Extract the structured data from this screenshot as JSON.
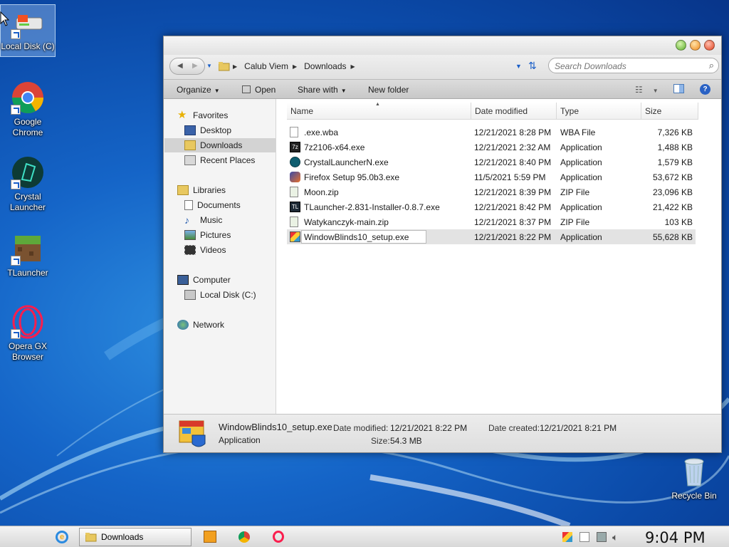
{
  "desktop": {
    "icons": [
      {
        "label": "Local Disk (C)"
      },
      {
        "label": "Google Chrome"
      },
      {
        "label": "Crystal Launcher"
      },
      {
        "label": "TLauncher"
      },
      {
        "label": "Opera GX Browser"
      },
      {
        "label": "Recycle Bin"
      }
    ]
  },
  "explorer": {
    "breadcrumb": [
      "Calub Viem",
      "Downloads"
    ],
    "search_placeholder": "Search Downloads",
    "toolbar": {
      "organize": "Organize",
      "open": "Open",
      "share_with": "Share with",
      "new_folder": "New folder"
    },
    "nav": {
      "favorites": "Favorites",
      "desktop": "Desktop",
      "downloads": "Downloads",
      "recent_places": "Recent Places",
      "libraries": "Libraries",
      "documents": "Documents",
      "music": "Music",
      "pictures": "Pictures",
      "videos": "Videos",
      "computer": "Computer",
      "local_disk": "Local Disk (C:)",
      "network": "Network"
    },
    "columns": {
      "name": "Name",
      "date_modified": "Date modified",
      "type": "Type",
      "size": "Size"
    },
    "files": [
      {
        "name": ".exe.wba",
        "date": "12/21/2021 8:28 PM",
        "type": "WBA File",
        "size": "7,326 KB"
      },
      {
        "name": "7z2106-x64.exe",
        "date": "12/21/2021 2:32 AM",
        "type": "Application",
        "size": "1,488 KB"
      },
      {
        "name": "CrystalLauncherN.exe",
        "date": "12/21/2021 8:40 PM",
        "type": "Application",
        "size": "1,579 KB"
      },
      {
        "name": "Firefox Setup 95.0b3.exe",
        "date": "11/5/2021 5:59 PM",
        "type": "Application",
        "size": "53,672 KB"
      },
      {
        "name": "Moon.zip",
        "date": "12/21/2021 8:39 PM",
        "type": "ZIP File",
        "size": "23,096 KB"
      },
      {
        "name": "TLauncher-2.831-Installer-0.8.7.exe",
        "date": "12/21/2021 8:42 PM",
        "type": "Application",
        "size": "21,422 KB"
      },
      {
        "name": "Watykanczyk-main.zip",
        "date": "12/21/2021 8:37 PM",
        "type": "ZIP File",
        "size": "103 KB"
      },
      {
        "name": "WindowBlinds10_setup.exe",
        "date": "12/21/2021 8:22 PM",
        "type": "Application",
        "size": "55,628 KB"
      }
    ],
    "details": {
      "filename": "WindowBlinds10_setup.exe",
      "filetype": "Application",
      "date_modified_label": "Date modified:",
      "date_modified": "12/21/2021 8:22 PM",
      "date_created_label": "Date created:",
      "date_created": "12/21/2021 8:21 PM",
      "size_label": "Size:",
      "size": "54.3 MB"
    }
  },
  "taskbar": {
    "active_window": "Downloads",
    "clock": "9:04 PM"
  },
  "colors": {
    "desktop_blue": "#1565c8",
    "selection_gray": "#e3e3e3",
    "close_red": "#e0401c",
    "max_orange": "#f08a1c",
    "min_green": "#5aae2a"
  }
}
